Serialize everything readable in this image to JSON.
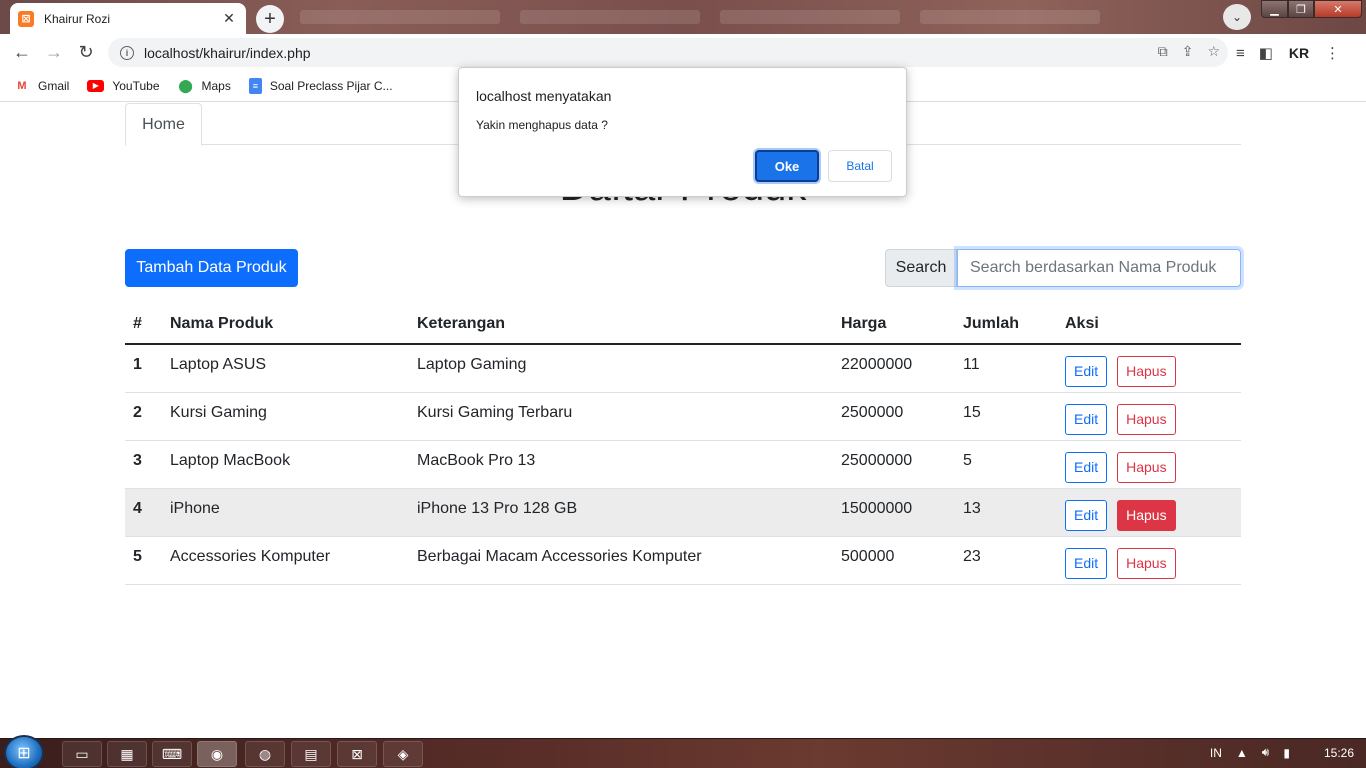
{
  "browser": {
    "tab_title": "Khairur Rozi",
    "tab_favicon": "xampp-icon",
    "url": "localhost/khairur/index.php",
    "avatar_initials": "KR"
  },
  "bookmarks": [
    {
      "label": "Gmail",
      "icon": "gmail-icon"
    },
    {
      "label": "YouTube",
      "icon": "youtube-icon"
    },
    {
      "label": "Maps",
      "icon": "maps-icon"
    },
    {
      "label": "Soal Preclass Pijar C...",
      "icon": "docs-icon"
    }
  ],
  "page": {
    "nav_home": "Home",
    "title": "Daftar Produk",
    "add_button": "Tambah Data Produk",
    "search_label": "Search",
    "search_placeholder": "Search berdasarkan Nama Produk"
  },
  "table": {
    "headers": [
      "#",
      "Nama Produk",
      "Keterangan",
      "Harga",
      "Jumlah",
      "Aksi"
    ],
    "edit_label": "Edit",
    "delete_label": "Hapus",
    "rows": [
      {
        "no": "1",
        "name": "Laptop ASUS",
        "desc": "Laptop Gaming",
        "price": "22000000",
        "qty": "11"
      },
      {
        "no": "2",
        "name": "Kursi Gaming",
        "desc": "Kursi Gaming Terbaru",
        "price": "2500000",
        "qty": "15"
      },
      {
        "no": "3",
        "name": "Laptop MacBook",
        "desc": "MacBook Pro 13",
        "price": "25000000",
        "qty": "5"
      },
      {
        "no": "4",
        "name": "iPhone",
        "desc": "iPhone 13 Pro 128 GB",
        "price": "15000000",
        "qty": "13"
      },
      {
        "no": "5",
        "name": "Accessories Komputer",
        "desc": "Berbagai Macam Accessories Komputer",
        "price": "500000",
        "qty": "23"
      }
    ]
  },
  "dialog": {
    "title": "localhost menyatakan",
    "message": "Yakin menghapus data ?",
    "ok_label": "Oke",
    "cancel_label": "Batal"
  },
  "taskbar": {
    "lang": "IN",
    "time": "15:26"
  },
  "colors": {
    "primary": "#0d6efd",
    "danger": "#dc3545",
    "dialog_ok": "#1a73e8"
  }
}
